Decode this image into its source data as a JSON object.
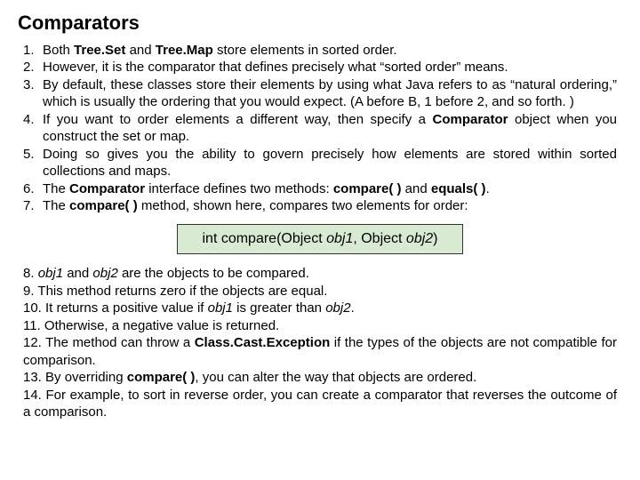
{
  "title": "Comparators",
  "para1": {
    "n1": "1.",
    "t1a": "Both ",
    "t1b": "Tree.Set",
    "t1c": " and ",
    "t1d": "Tree.Map",
    "t1e": " store elements in sorted order.",
    "n2": "2.",
    "t2": "However, it is the comparator that defines precisely what “sorted order” means.",
    "n3": "3.",
    "t3": "By default, these classes store their elements by using what Java refers to as “natural ordering,” which is usually the ordering that you would expect. (A before B, 1 before 2, and so forth. )",
    "n4": "4.",
    "t4a": "If you want to order elements a different way, then specify a ",
    "t4b": "Comparator",
    "t4c": " object when you construct the set or map.",
    "n5": "5.",
    "t5": "Doing so gives you the ability to govern precisely how elements are stored within sorted collections and maps.",
    "n6": "6.",
    "t6a": "The ",
    "t6b": "Comparator",
    "t6c": " interface defines two methods: ",
    "t6d": "compare( )",
    "t6e": " and ",
    "t6f": "equals( )",
    "t6g": ".",
    "n7": "7.",
    "t7a": "The ",
    "t7b": "compare( )",
    "t7c": " method, shown here, compares two elements for order:"
  },
  "signature": {
    "a": "int compare(Object ",
    "b": "obj1",
    "c": ", Object ",
    "d": "obj2",
    "e": ")"
  },
  "para2": {
    "t8a": "8. ",
    "t8b": "obj1",
    "t8c": " and ",
    "t8d": "obj2",
    "t8e": " are the objects to be compared.",
    "t9": "9. This method returns zero if the objects are equal.",
    "t10a": "10. It returns a positive value if ",
    "t10b": "obj1",
    "t10c": " is greater than ",
    "t10d": "obj2",
    "t10e": ".",
    "t11": "11. Otherwise, a negative value is returned.",
    "t12a": "12. The method can throw a ",
    "t12b": "Class.Cast.Exception",
    "t12c": " if the types of the objects are not compatible for comparison.",
    "t13a": "13. By overriding ",
    "t13b": "compare( )",
    "t13c": ", you can alter the way that objects are ordered.",
    "t14": "14. For example, to sort in reverse order, you can create a comparator that reverses the outcome of a comparison."
  }
}
